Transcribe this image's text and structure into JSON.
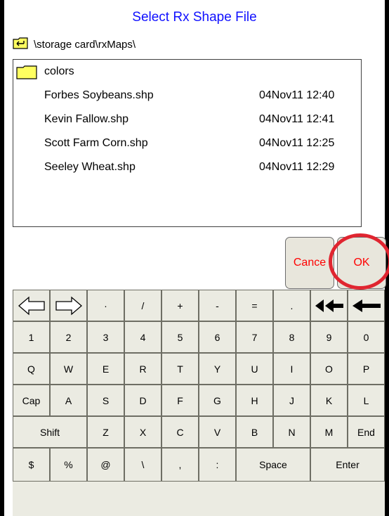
{
  "dialog": {
    "title": "Select Rx Shape File",
    "path": "\\storage card\\rxMaps\\"
  },
  "files": [
    {
      "name": "colors",
      "date": "",
      "icon": "folder-icon"
    },
    {
      "name": "Forbes Soybeans.shp",
      "date": "04Nov11 12:40"
    },
    {
      "name": "Kevin Fallow.shp",
      "date": "04Nov11 12:41"
    },
    {
      "name": "Scott Farm Corn.shp",
      "date": "04Nov11 12:25"
    },
    {
      "name": "Seeley Wheat.shp",
      "date": "04Nov11 12:29"
    }
  ],
  "buttons": {
    "cancel": "Cance",
    "ok": "OK"
  },
  "keyboard": {
    "row1": [
      "·",
      "/",
      "+",
      "-",
      "=",
      "."
    ],
    "row2": [
      "1",
      "2",
      "3",
      "4",
      "5",
      "6",
      "7",
      "8",
      "9",
      "0"
    ],
    "row3": [
      "Q",
      "W",
      "E",
      "R",
      "T",
      "Y",
      "U",
      "I",
      "O",
      "P"
    ],
    "row4": [
      "Cap",
      "A",
      "S",
      "D",
      "F",
      "G",
      "H",
      "J",
      "K",
      "L"
    ],
    "row5": [
      "Shift",
      "Z",
      "X",
      "C",
      "V",
      "B",
      "N",
      "M",
      "End"
    ],
    "row6": [
      "$",
      "%",
      "@",
      "\\",
      ",",
      ":",
      "Space",
      "Enter"
    ]
  },
  "colors": {
    "title": "#1010ff",
    "button_text": "#ff0000",
    "highlight_ring": "#e02530"
  }
}
